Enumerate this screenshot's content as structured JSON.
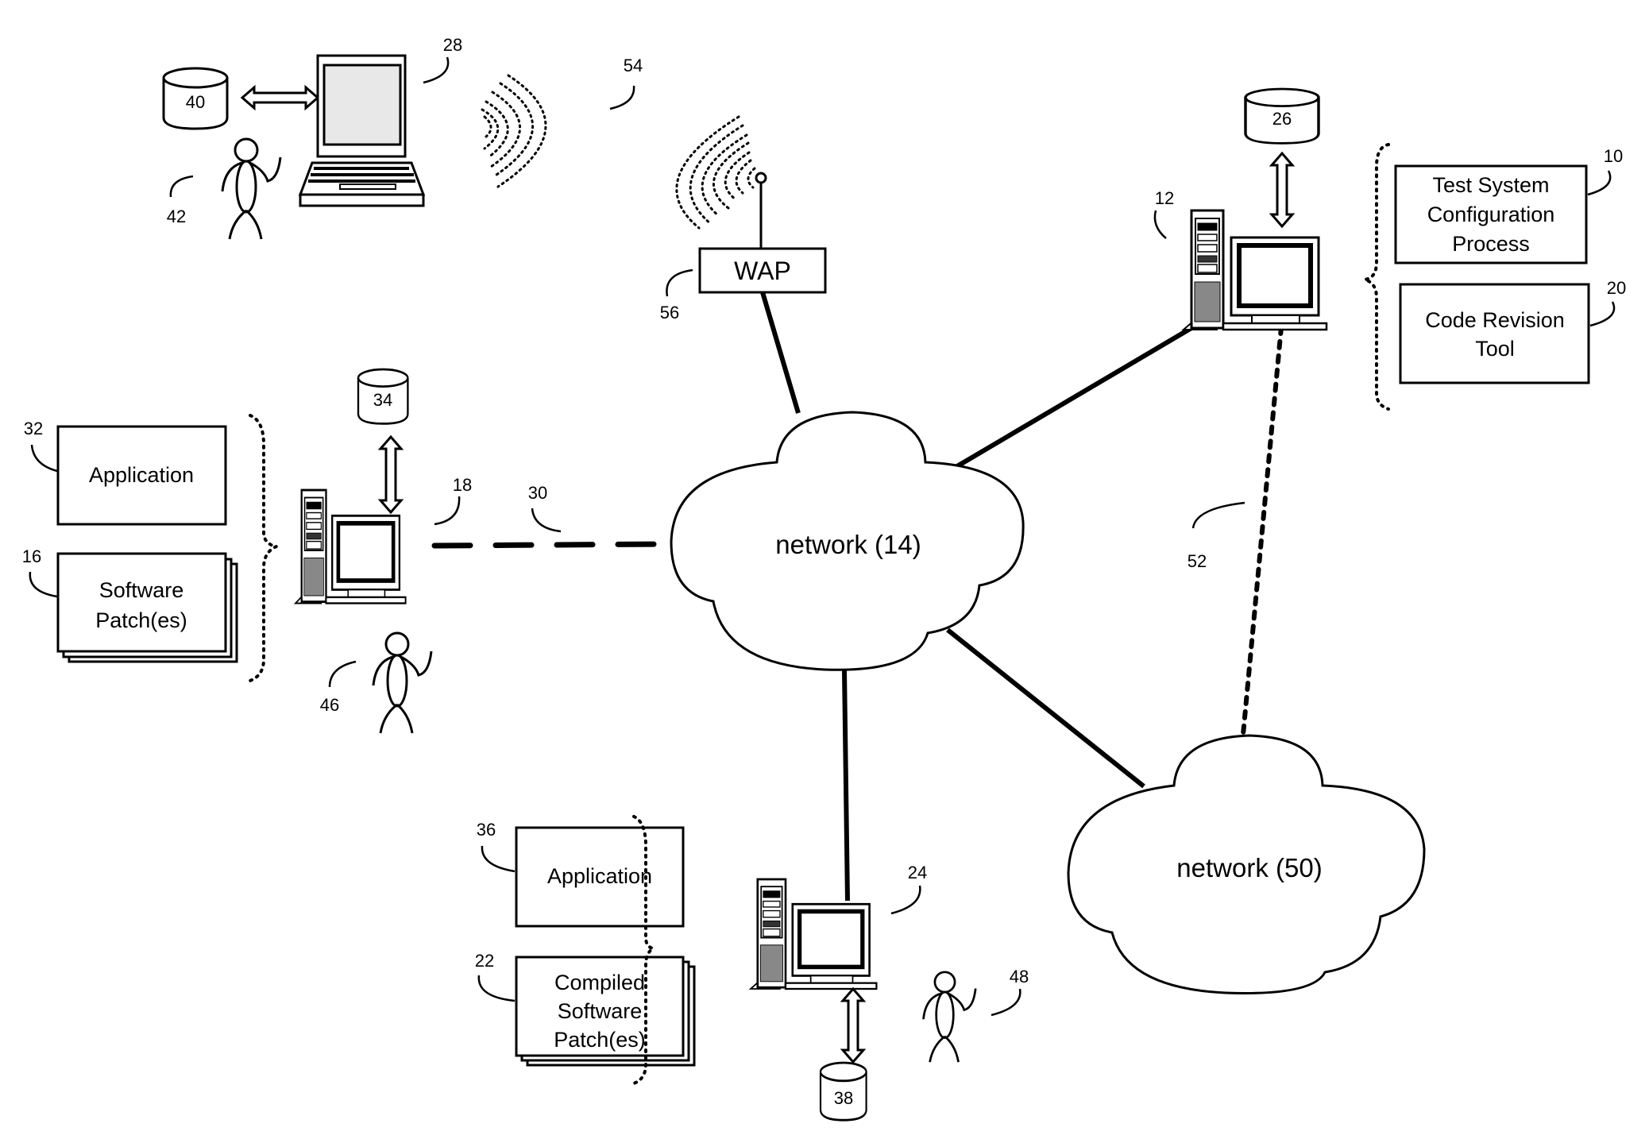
{
  "diagram": {
    "networks": [
      {
        "id": "14",
        "label": "network (14)"
      },
      {
        "id": "50",
        "label": "network (50)"
      }
    ],
    "wap": {
      "label": "WAP",
      "ref": "56"
    },
    "boxes": {
      "test_system": {
        "lines": [
          "Test System",
          "Configuration",
          "Process"
        ],
        "ref": "10"
      },
      "code_revision": {
        "lines": [
          "Code Revision",
          "Tool"
        ],
        "ref": "20"
      },
      "application_32": {
        "lines": [
          "Application"
        ],
        "ref": "32"
      },
      "software_patch_16": {
        "lines": [
          "Software",
          "Patch(es)"
        ],
        "ref": "16"
      },
      "application_36": {
        "lines": [
          "Application"
        ],
        "ref": "36"
      },
      "compiled_patch_22": {
        "lines": [
          "Compiled",
          "Software",
          "Patch(es)"
        ],
        "ref": "22"
      }
    },
    "databases": {
      "db40": "40",
      "db26": "26",
      "db34": "34",
      "db38": "38"
    },
    "refs": {
      "laptop": "28",
      "wireless_laptop": "54",
      "user42": "42",
      "server12": "12",
      "computer18": "18",
      "link30": "30",
      "user46": "46",
      "link52": "52",
      "computer24": "24",
      "user48": "48"
    }
  }
}
